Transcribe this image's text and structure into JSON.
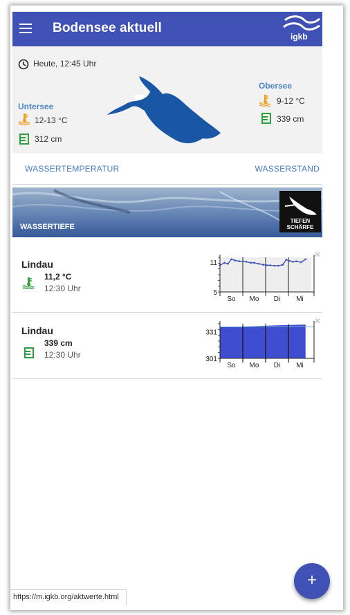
{
  "appbar": {
    "title": "Bodensee aktuell",
    "logo_text": "igkb"
  },
  "overview": {
    "timestamp": "Heute, 12:45 Uhr",
    "untersee": {
      "name": "Untersee",
      "temperature": "12-13 °C",
      "level": "312 cm"
    },
    "obersee": {
      "name": "Obersee",
      "temperature": "9-12 °C",
      "level": "339 cm"
    }
  },
  "tabs": [
    {
      "label": "WASSERTEMPERATUR"
    },
    {
      "label": "WASSERSTAND"
    }
  ],
  "banner": {
    "title": "WASSERTIEFE",
    "badge_line1": "TIEFEN",
    "badge_line2": "SCHÄRFE"
  },
  "stations": [
    {
      "name": "Lindau",
      "value": "11,2 °C",
      "time": "12:30 Uhr",
      "chart": {
        "y_ticks": [
          "11",
          "5"
        ],
        "x_labels": [
          "So",
          "Mo",
          "Di",
          "Mi"
        ]
      }
    },
    {
      "name": "Lindau",
      "value": "339 cm",
      "time": "12:30 Uhr",
      "chart": {
        "y_ticks": [
          "331",
          "301"
        ],
        "x_labels": [
          "So",
          "Mo",
          "Di",
          "Mi"
        ]
      }
    }
  ],
  "chart_data": [
    {
      "type": "line",
      "title": "",
      "xlabel": "",
      "ylabel": "",
      "categories": [
        "So",
        "Mo",
        "Di",
        "Mi"
      ],
      "ylim": [
        5,
        12
      ],
      "x": [
        0.0,
        0.2,
        0.35,
        0.5,
        0.65,
        0.85,
        1.0,
        1.15,
        1.35,
        1.5,
        1.7,
        1.9,
        2.05,
        2.2,
        2.4,
        2.55,
        2.75,
        2.9,
        3.05,
        3.2,
        3.35,
        3.55,
        3.75
      ],
      "values": [
        10.4,
        10.9,
        10.7,
        11.6,
        11.4,
        11.2,
        11.2,
        11.1,
        10.9,
        10.9,
        10.7,
        10.5,
        10.4,
        10.4,
        10.3,
        10.3,
        10.5,
        11.5,
        11.3,
        11.1,
        11.2,
        11.0,
        11.6
      ],
      "colors": {
        "line": "#3f51b5",
        "fill": "#eeeeee"
      }
    },
    {
      "type": "area",
      "title": "",
      "xlabel": "",
      "ylabel": "",
      "categories": [
        "So",
        "Mo",
        "Di",
        "Mi"
      ],
      "ylim": [
        301,
        340
      ],
      "x": [
        0,
        0.5,
        1,
        1.5,
        2,
        2.5,
        3,
        3.5,
        3.75
      ],
      "values": [
        336.5,
        336.8,
        337.0,
        337.4,
        337.8,
        338.2,
        338.5,
        338.9,
        339
      ],
      "colors": {
        "fill": "#3f4ed0",
        "reference_line": "#7fb3e6"
      }
    }
  ],
  "colors": {
    "primary": "#3f51b5",
    "accent": "#4a7bc0",
    "temp_icon": "#f0a020",
    "level_icon": "#2e9e3e"
  },
  "status": {
    "url": "https://m.igkb.org/aktwerte.html"
  },
  "fab": {
    "label": "+"
  }
}
